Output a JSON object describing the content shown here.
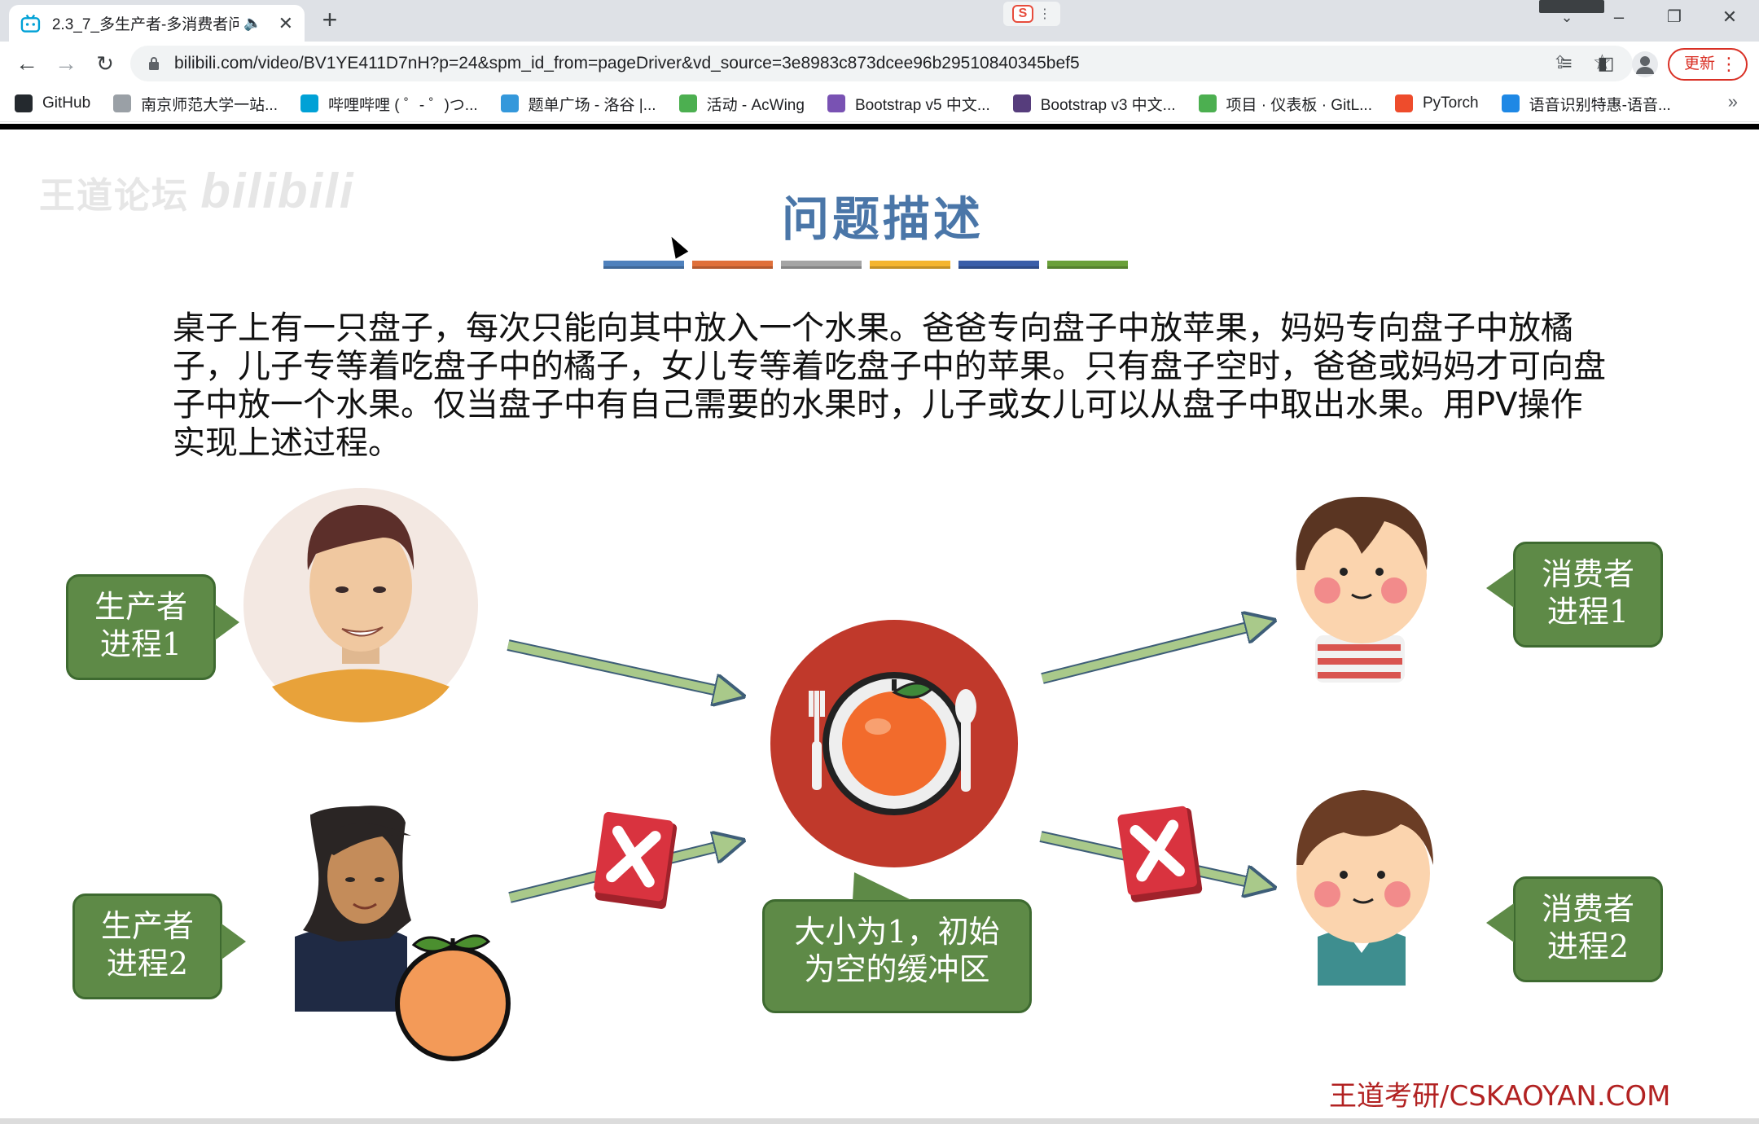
{
  "browser": {
    "tab_title": "2.3_7_多生产者-多消费者问",
    "url": "bilibili.com/video/BV1YE411D7nH?p=24&spm_id_from=pageDriver&vd_source=3e8983c873dcee96b29510840345bef5",
    "update_label": "更新",
    "bookmarks": [
      {
        "label": "GitHub",
        "icon": "github-icon",
        "color": "#24292e"
      },
      {
        "label": "南京师范大学一站...",
        "icon": "house-icon",
        "color": "#9aa0a6"
      },
      {
        "label": "哔哩哔哩 ( ゜- ゜)つ...",
        "icon": "bilibili-icon",
        "color": "#00a1d6"
      },
      {
        "label": "题单广场 - 洛谷 |...",
        "icon": "luogu-icon",
        "color": "#3498db"
      },
      {
        "label": "活动 - AcWing",
        "icon": "acwing-icon",
        "color": "#4caf50"
      },
      {
        "label": "Bootstrap v5 中文...",
        "icon": "bootstrap-icon",
        "color": "#7952b3"
      },
      {
        "label": "Bootstrap v3 中文...",
        "icon": "bootstrap-icon",
        "color": "#563d7c"
      },
      {
        "label": "项目 · 仪表板 · GitL...",
        "icon": "gitlab-icon",
        "color": "#4caf50"
      },
      {
        "label": "PyTorch",
        "icon": "pytorch-icon",
        "color": "#ee4c2c"
      },
      {
        "label": "语音识别特惠-语音...",
        "icon": "cloud-icon",
        "color": "#1e88e5"
      }
    ]
  },
  "slide": {
    "watermark": "王道论坛",
    "title": "问题描述",
    "title_bar_colors": [
      "#4f81bd",
      "#e0703a",
      "#a5a5a5",
      "#f5b52e",
      "#3a5ea9",
      "#6aa03a"
    ],
    "description": "桌子上有一只盘子，每次只能向其中放入一个水果。爸爸专向盘子中放苹果，妈妈专向盘子中放橘子，儿子专等着吃盘子中的橘子，女儿专等着吃盘子中的苹果。只有盘子空时，爸爸或妈妈才可向盘子中放一个水果。仅当盘子中有自己需要的水果时，儿子或女儿可以从盘子中取出水果。用PV操作实现上述过程。",
    "producer1": {
      "line1": "生产者",
      "line2": "进程1"
    },
    "producer2": {
      "line1": "生产者",
      "line2": "进程2"
    },
    "consumer1": {
      "line1": "消费者",
      "line2": "进程1"
    },
    "consumer2": {
      "line1": "消费者",
      "line2": "进程2"
    },
    "buffer": {
      "line1": "大小为1，初始",
      "line2": "为空的缓冲区"
    },
    "credit": "王道考研/CSKAOYAN.COM",
    "colors": {
      "bubble": "#5e8a47",
      "arrow": "#a9c98a",
      "plate": "#c0392b",
      "cross": "#d9333f"
    }
  }
}
